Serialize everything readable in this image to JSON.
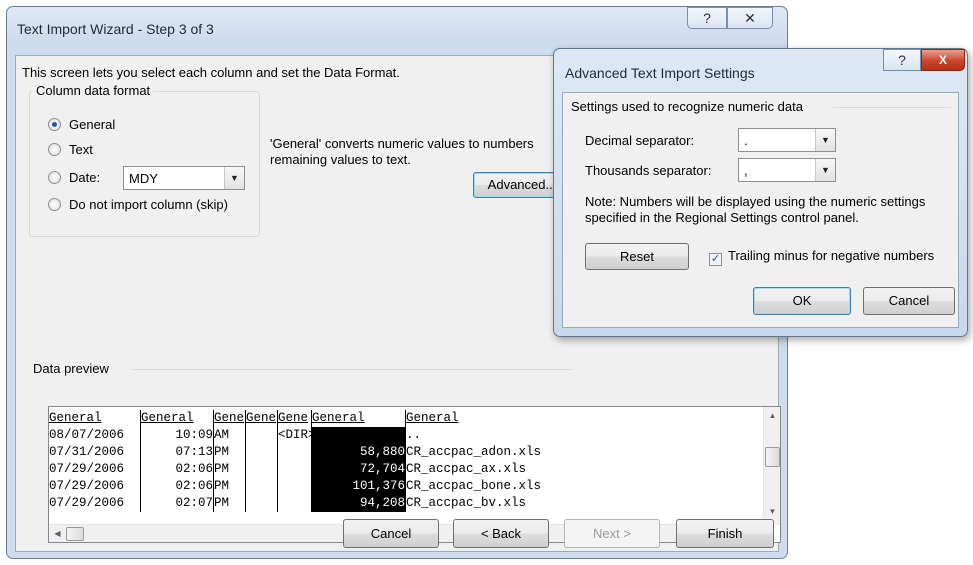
{
  "wizard": {
    "title": "Text Import Wizard - Step 3 of 3",
    "help_glyph": "?",
    "close_glyph": "✕",
    "intro": "This screen lets you select each column and set the Data Format.",
    "group_title": "Column data format",
    "options": {
      "general": "General",
      "text": "Text",
      "date": "Date:",
      "skip": "Do not import column (skip)"
    },
    "selected_option": "General",
    "date_format": "MDY",
    "description_line1": "'General' converts numeric values to numbers",
    "description_line2": "remaining values to text.",
    "advanced_label": "Advanced...",
    "preview_label": "Data preview",
    "preview": {
      "headers": [
        "General",
        "General",
        "Gene",
        "Gene",
        "Gene",
        "General",
        "General"
      ],
      "rows": [
        [
          "08/07/2006",
          "10:09",
          "AM",
          "",
          "<DIR>",
          "",
          ".."
        ],
        [
          "07/31/2006",
          "07:13",
          "PM",
          "",
          "",
          "58,880",
          "CR_accpac_adon.xls"
        ],
        [
          "07/29/2006",
          "02:06",
          "PM",
          "",
          "",
          "72,704",
          "CR_accpac_ax.xls"
        ],
        [
          "07/29/2006",
          "02:06",
          "PM",
          "",
          "",
          "101,376",
          "CR_accpac_bone.xls"
        ],
        [
          "07/29/2006",
          "02:07",
          "PM",
          "",
          "",
          "94,208",
          "CR_accpac_bv.xls"
        ]
      ],
      "selected_column": 5
    },
    "buttons": {
      "cancel": "Cancel",
      "back": "< Back",
      "next": "Next >",
      "finish": "Finish"
    }
  },
  "advanced": {
    "title": "Advanced Text Import Settings",
    "help_glyph": "?",
    "close_glyph": "X",
    "group_title": "Settings used to recognize numeric data",
    "decimal_label": "Decimal separator:",
    "decimal_value": ".",
    "thousands_label": "Thousands separator:",
    "thousands_value": ",",
    "note_line1": "Note: Numbers will be displayed using the numeric settings",
    "note_line2": "specified in the Regional Settings control panel.",
    "reset_label": "Reset",
    "trailing_minus_label": "Trailing minus for negative numbers",
    "trailing_minus_checked": true,
    "ok_label": "OK",
    "cancel_label": "Cancel"
  },
  "icons": {
    "radio": "radio-circle",
    "combo_arrow": "triangle-down",
    "scroll_up": "triangle-up",
    "scroll_down": "triangle-down",
    "scroll_left": "triangle-left",
    "scroll_right": "triangle-right",
    "check": "checkmark"
  },
  "colors": {
    "title_bar": "#cfdced",
    "client": "#f0f0f0",
    "selection": "#000000",
    "close_red": "#c9442b"
  }
}
